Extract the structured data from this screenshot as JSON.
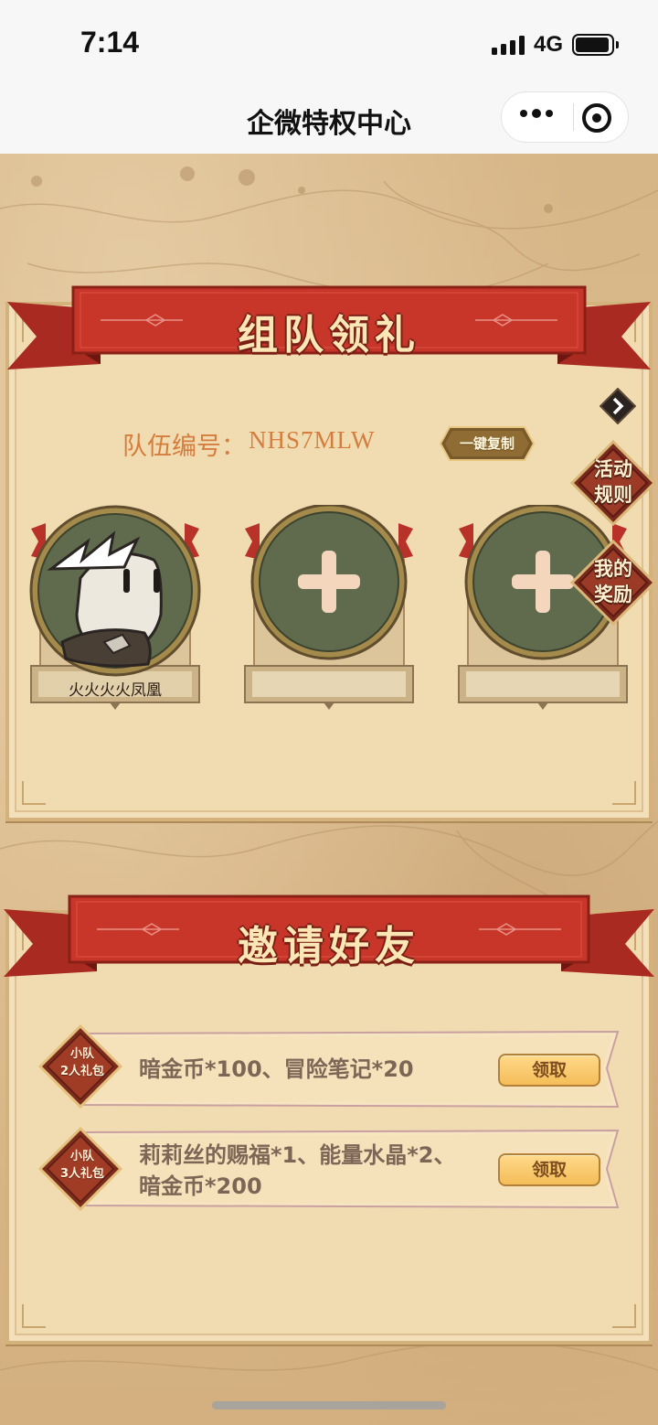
{
  "status_bar": {
    "time": "7:14",
    "network": "4G"
  },
  "nav": {
    "title": "企微特权中心"
  },
  "team_section": {
    "banner_title": "组队领礼",
    "team_code_label": "队伍编号：",
    "team_code_value": "NHS7MLW",
    "copy_button_label": "一键复制",
    "rules_badge_line1": "活动",
    "rules_badge_line2": "规则",
    "rewards_badge_line1": "我的",
    "rewards_badge_line2": "奖励",
    "members": [
      {
        "name": "火火火火凤凰",
        "filled": true
      },
      {
        "name": "",
        "filled": false
      },
      {
        "name": "",
        "filled": false
      }
    ]
  },
  "invite_section": {
    "banner_title": "邀请好友",
    "rewards": [
      {
        "pack_line1": "小队",
        "pack_line2": "2人礼包",
        "items_line1": "暗金币*100、冒险笔记*20",
        "items_line2": "",
        "claim_label": "领取"
      },
      {
        "pack_line1": "小队",
        "pack_line2": "3人礼包",
        "items_line1": "莉莉丝的赐福*1、能量水晶*2、",
        "items_line2": "暗金币*200",
        "claim_label": "领取"
      }
    ]
  },
  "colors": {
    "ribbon_red": "#c8362a",
    "parchment": "#f1dcb2",
    "accent_orange": "#d47d3e",
    "slot_green": "#5f6b4c"
  }
}
